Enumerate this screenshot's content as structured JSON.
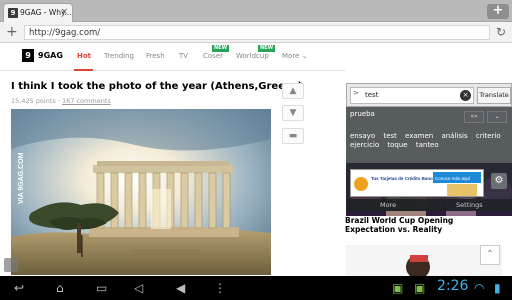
{
  "browser": {
    "tab_title": "9GAG - Why...",
    "tab_close": "×",
    "new_tab": "+",
    "url": "http://9gag.com/"
  },
  "site": {
    "logo_letter": "9",
    "name": "9GAG",
    "nav": [
      "Hot",
      "Trending",
      "Fresh",
      "TV",
      "Coser",
      "Worldcup",
      "More"
    ],
    "new_badge": "NEW",
    "more_chevron": "⌄"
  },
  "post": {
    "title": "I think I took the photo of the year (Athens,Greece)",
    "points": "15,425 points",
    "separator": "·",
    "comments": "167 comments",
    "watermark": "VIA 9GAG.COM"
  },
  "sidebar": {
    "ad_title": "Brazil World Cup Opening Expectation vs. Reality",
    "scroll_top": "⌃"
  },
  "translate": {
    "arrow": ">",
    "query": "test",
    "clear": "×",
    "button": "Translate",
    "result": "prueba",
    "ctrl1": "«»",
    "ctrl2": "⌄",
    "suggestions": [
      "ensayo",
      "test",
      "examen",
      "análisis",
      "criterio",
      "ejercicio",
      "toque",
      "tanteo"
    ],
    "ad_text": "Tus Tarjetas de Crédito Banco de Bogotá te llevan",
    "ad_btn": "Conoce más aquí",
    "footer_more": "More",
    "footer_settings": "Settings"
  },
  "system": {
    "time": "2:26"
  }
}
